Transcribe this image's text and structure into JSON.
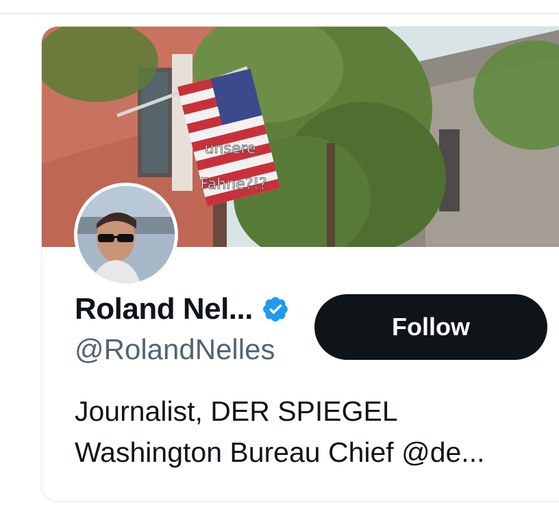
{
  "profile": {
    "name": "Roland Nel...",
    "handle": "@RolandNelles",
    "verified_icon": "verified-badge-icon",
    "bio_line1": "Journalist, DER SPIEGEL",
    "bio_line2": "Washington Bureau Chief @de..."
  },
  "banner": {
    "caption_line1": "unsere",
    "caption_line2": "Fahne?!?"
  },
  "actions": {
    "follow_label": "Follow"
  },
  "colors": {
    "accent": "#1d9bf0",
    "follow_bg": "#0f1419",
    "text_primary": "#0f1419",
    "text_secondary": "#536471"
  }
}
